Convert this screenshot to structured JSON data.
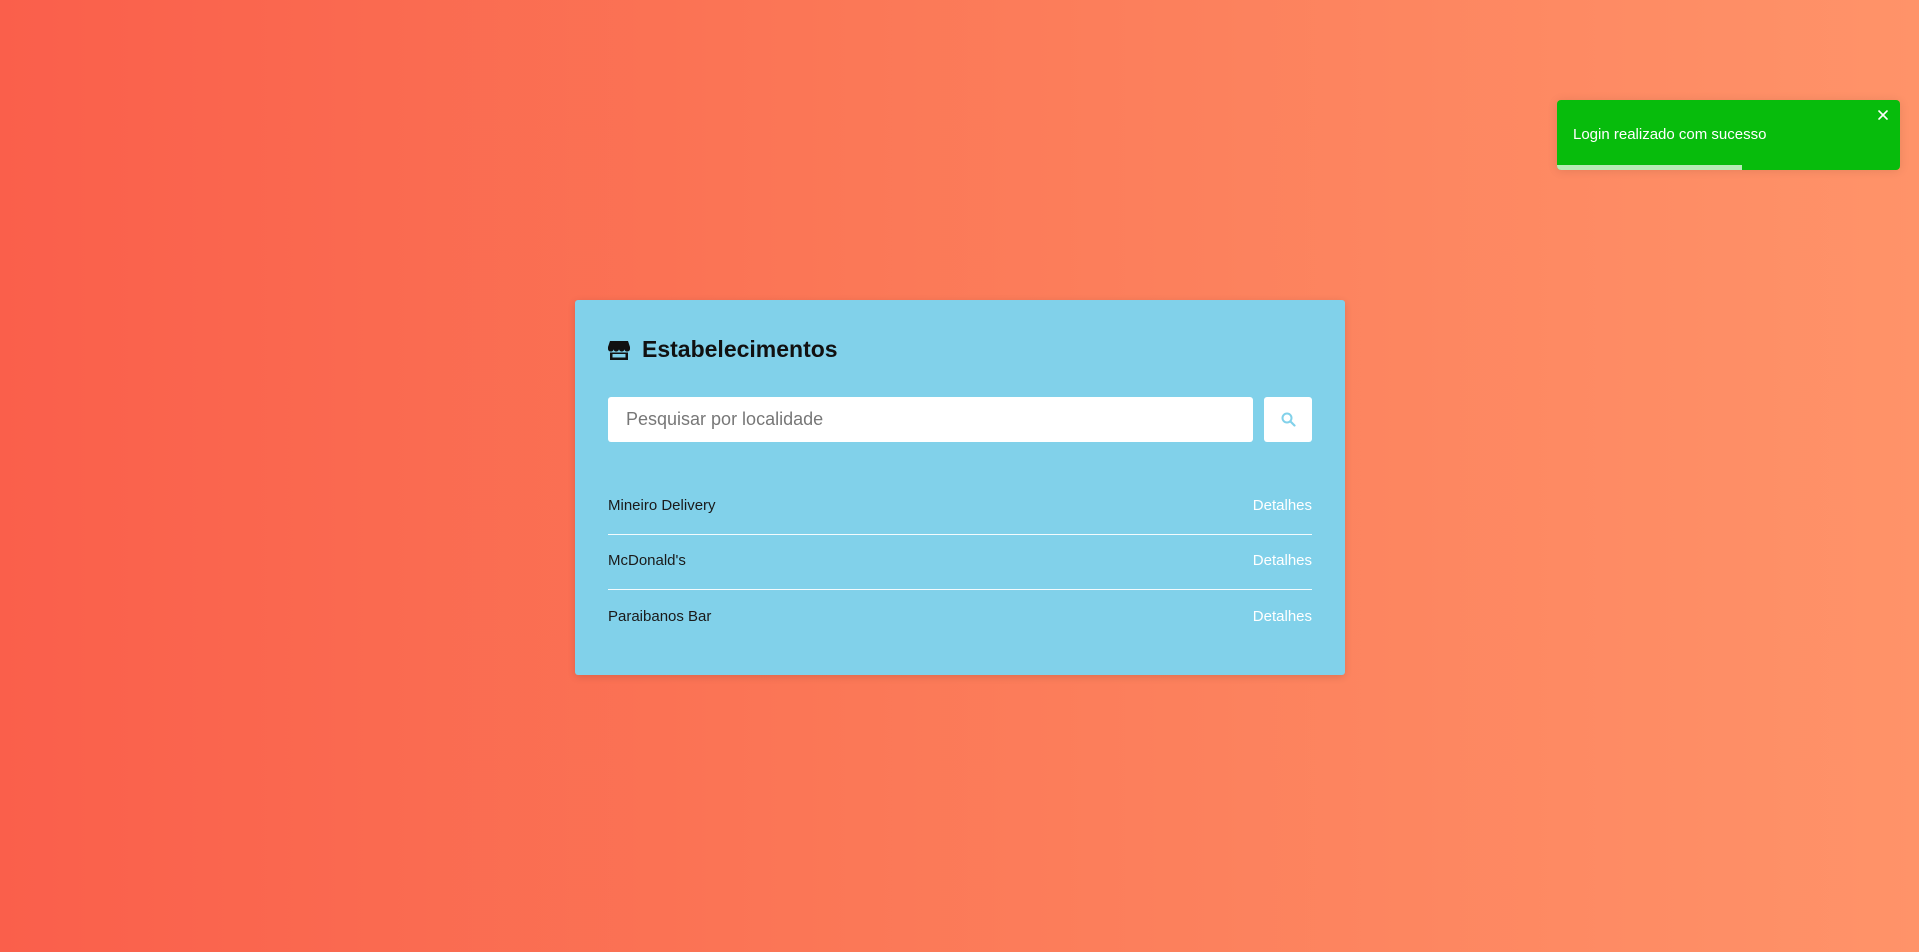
{
  "panel": {
    "title": "Estabelecimentos",
    "title_icon": "store-icon",
    "background": "#81d1ea"
  },
  "search": {
    "placeholder": "Pesquisar por localidade",
    "value": "",
    "button_icon": "search-icon"
  },
  "establishments": [
    {
      "name": "Mineiro Delivery",
      "action": "Detalhes"
    },
    {
      "name": "McDonald's",
      "action": "Detalhes"
    },
    {
      "name": "Paraibanos Bar",
      "action": "Detalhes"
    }
  ],
  "toast": {
    "message": "Login realizado com sucesso",
    "type": "success",
    "color": "#07bc0c",
    "close_icon": "close-icon",
    "progress": 0.54
  },
  "colors": {
    "background_start": "#fa5f4b",
    "background_end": "#ff9369",
    "accent": "#81d1ea"
  }
}
